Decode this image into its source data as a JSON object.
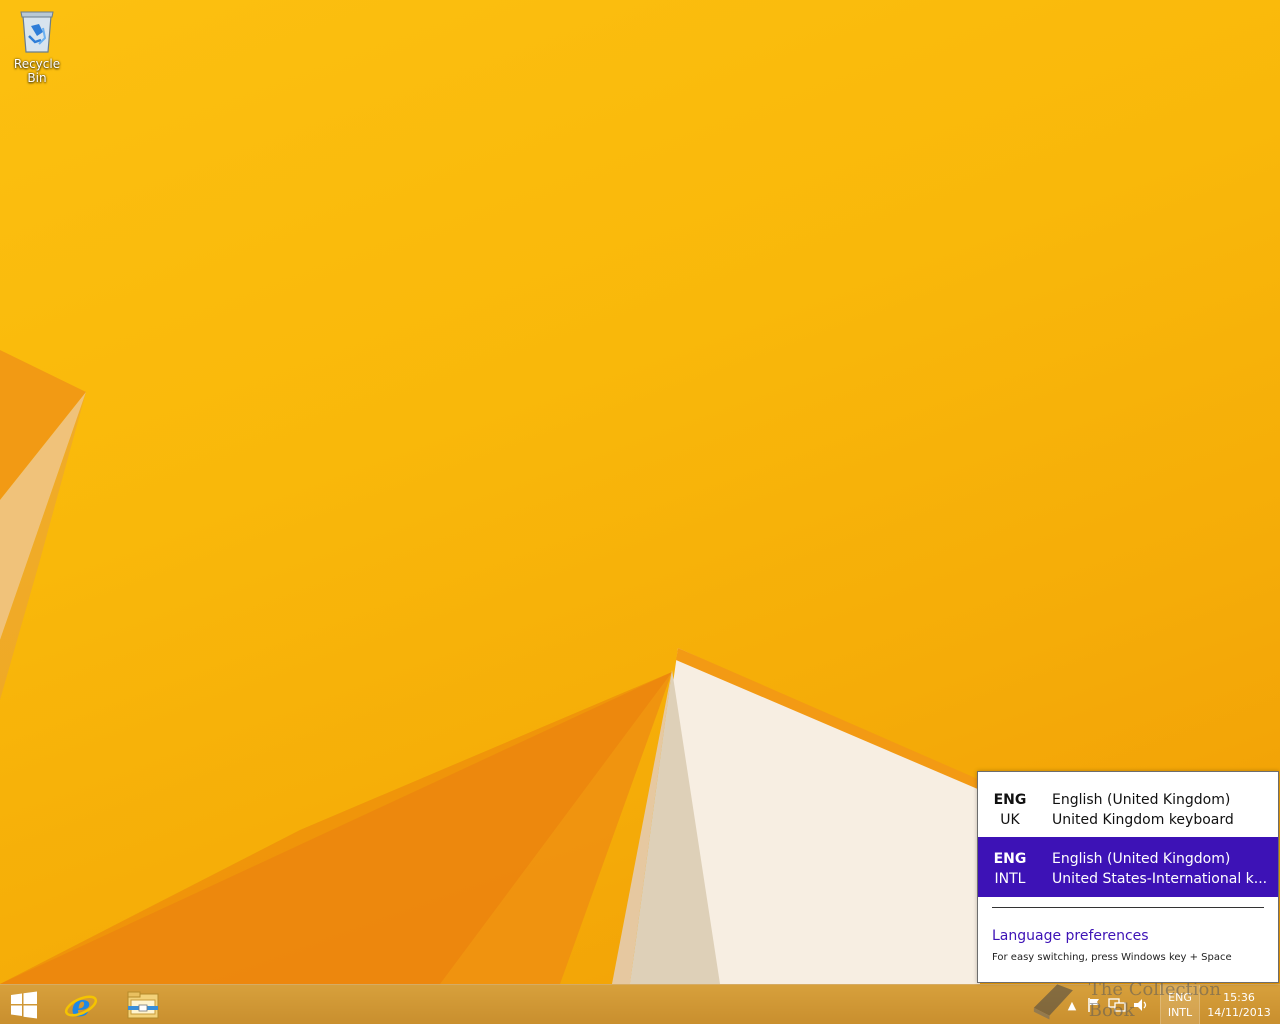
{
  "desktop": {
    "icons": [
      {
        "label": "Recycle Bin",
        "icon": "recycle-bin-icon"
      }
    ]
  },
  "taskbar": {
    "pinned": [
      {
        "name": "Start",
        "icon": "windows-logo-icon"
      },
      {
        "name": "Internet Explorer",
        "icon": "internet-explorer-icon"
      },
      {
        "name": "File Explorer",
        "icon": "file-explorer-icon"
      }
    ],
    "tray": {
      "language": {
        "code": "ENG",
        "layout": "INTL"
      },
      "clock": {
        "time": "15:36",
        "date": "14/11/2013"
      },
      "icons": [
        "show-hidden-icons-chevron",
        "action-center-flag-icon",
        "network-icon",
        "volume-icon"
      ]
    }
  },
  "language_flyout": {
    "items": [
      {
        "code": "ENG",
        "layout_code": "UK",
        "language": "English (United Kingdom)",
        "keyboard": "United Kingdom keyboard",
        "selected": false
      },
      {
        "code": "ENG",
        "layout_code": "INTL",
        "language": "English (United Kingdom)",
        "keyboard": "United States-International k...",
        "selected": true
      }
    ],
    "preferences_link": "Language preferences",
    "hint": "For easy switching, press Windows key + Space"
  },
  "watermark": {
    "text": "The Collection Book"
  },
  "colors": {
    "accent": "#3d12b6",
    "desktop": "#f9b80a",
    "taskbar": "#d09733"
  }
}
